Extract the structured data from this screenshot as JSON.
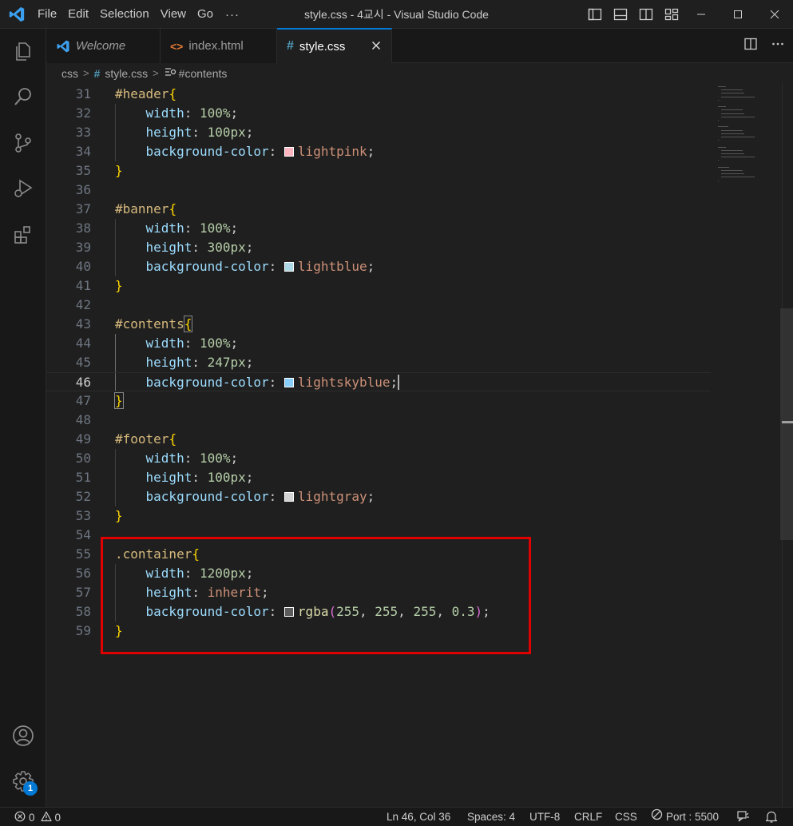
{
  "titlebar": {
    "menu": [
      "File",
      "Edit",
      "Selection",
      "View",
      "Go"
    ],
    "more": "···",
    "title": "style.css - 4교시 - Visual Studio Code"
  },
  "tabs": [
    {
      "label": "Welcome",
      "icon": "vscode-logo-icon"
    },
    {
      "label": "index.html",
      "icon": "html-file-icon",
      "glyph": "<>"
    },
    {
      "label": "style.css",
      "icon": "css-file-icon",
      "glyph": "#"
    }
  ],
  "breadcrumbs": {
    "folder": "css",
    "file": "style.css",
    "symbol": "#contents"
  },
  "editor": {
    "lines": [
      {
        "n": "31",
        "sel": "#header",
        "open": "{"
      },
      {
        "n": "32",
        "prop": "width",
        "num": "100%"
      },
      {
        "n": "33",
        "prop": "height",
        "num": "100px"
      },
      {
        "n": "34",
        "prop": "background-color",
        "color": "#ffb6c1",
        "val": "lightpink"
      },
      {
        "n": "35",
        "close": "}"
      },
      {
        "n": "36"
      },
      {
        "n": "37",
        "sel": "#banner",
        "open": "{"
      },
      {
        "n": "38",
        "prop": "width",
        "num": "100%"
      },
      {
        "n": "39",
        "prop": "height",
        "num": "300px"
      },
      {
        "n": "40",
        "prop": "background-color",
        "color": "#add8e6",
        "val": "lightblue"
      },
      {
        "n": "41",
        "close": "}"
      },
      {
        "n": "42"
      },
      {
        "n": "43",
        "sel": "#contents",
        "open": "{"
      },
      {
        "n": "44",
        "prop": "width",
        "num": "100%"
      },
      {
        "n": "45",
        "prop": "height",
        "num": "247px"
      },
      {
        "n": "46",
        "prop": "background-color",
        "color": "#87cefa",
        "val": "lightskyblue"
      },
      {
        "n": "47",
        "close": "}"
      },
      {
        "n": "48"
      },
      {
        "n": "49",
        "sel": "#footer",
        "open": "{"
      },
      {
        "n": "50",
        "prop": "width",
        "num": "100%"
      },
      {
        "n": "51",
        "prop": "height",
        "num": "100px"
      },
      {
        "n": "52",
        "prop": "background-color",
        "color": "#d3d3d3",
        "val": "lightgray"
      },
      {
        "n": "53",
        "close": "}"
      },
      {
        "n": "54"
      },
      {
        "n": "55",
        "sel": ".container",
        "open": "{"
      },
      {
        "n": "56",
        "prop": "width",
        "num": "1200px"
      },
      {
        "n": "57",
        "prop": "height",
        "val": "inherit"
      },
      {
        "n": "58",
        "prop": "background-color",
        "color": "#5c5c5c",
        "rgba": [
          "255",
          "255",
          "255",
          "0.3"
        ]
      },
      {
        "n": "59",
        "close": "}"
      }
    ]
  },
  "statusbar": {
    "errors": "0",
    "warnings": "0",
    "position": "Ln 46, Col 36",
    "spaces": "Spaces: 4",
    "encoding": "UTF-8",
    "eol": "CRLF",
    "language": "CSS",
    "port": "Port : 5500"
  },
  "activity": {
    "settings_badge": "1"
  },
  "colors": {
    "accent": "#0078d4",
    "highlight_box": "#e00000"
  }
}
